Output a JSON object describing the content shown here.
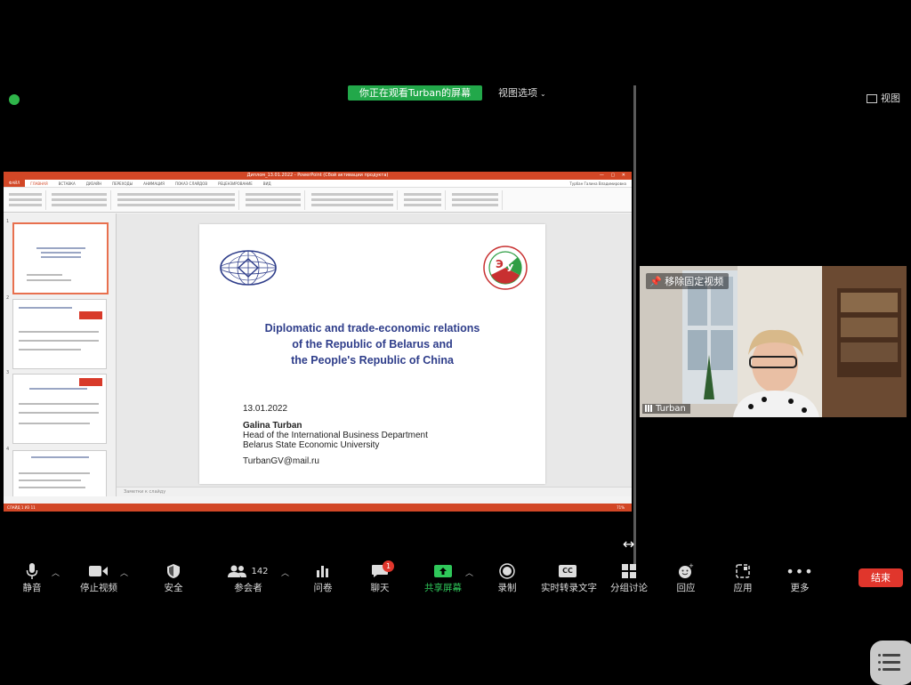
{
  "top_bar": {
    "share_banner": "你正在观看Turban的屏幕",
    "view_options": "视图选项",
    "view_toggle": "视图"
  },
  "ppt": {
    "window_title": "Диплом_13.01.2022 - PowerPoint (Сбой активации продукта)",
    "tabs": [
      "ФАЙЛ",
      "ГЛАВНАЯ",
      "ВСТАВКА",
      "ДИЗАЙН",
      "ПЕРЕХОДЫ",
      "АНИМАЦИЯ",
      "ПОКАЗ СЛАЙДОВ",
      "РЕЦЕНЗИРОВАНИЕ",
      "ВИД"
    ],
    "user": "Турбан Галина Владимировна",
    "notes_placeholder": "Заметки к слайду",
    "status_left": "СЛАЙД 1 ИЗ 11",
    "status_zoom": "71%"
  },
  "slide": {
    "title_lines": [
      "Diplomatic and trade-economic relations",
      "of the Republic of Belarus and",
      "the People's Republic of China"
    ],
    "date": "13.01.2022",
    "presenter_name": "Galina Turban",
    "presenter_role": "Head of the International Business Department",
    "presenter_org": "Belarus State Economic University",
    "email": "TurbanGV@mail.ru",
    "logo_letters": "ЭУ"
  },
  "video": {
    "pin_label": "移除固定视频",
    "participant_name": "Turban"
  },
  "toolbar": {
    "mute": "静音",
    "stop_video": "停止视频",
    "security": "安全",
    "participants": "参会者",
    "participant_count": "142",
    "polls": "问卷",
    "chat": "聊天",
    "chat_badge": "1",
    "share_screen": "共享屏幕",
    "record": "录制",
    "live_transcript": "实时转录文字",
    "cc_icon_text": "CC",
    "breakout": "分组讨论",
    "reactions": "回应",
    "apps": "应用",
    "more": "更多",
    "end": "结束"
  },
  "colors": {
    "share_green": "#22a84a",
    "end_red": "#e0362c",
    "ppt_orange": "#d24726",
    "slide_title_blue": "#2e3d8a"
  }
}
